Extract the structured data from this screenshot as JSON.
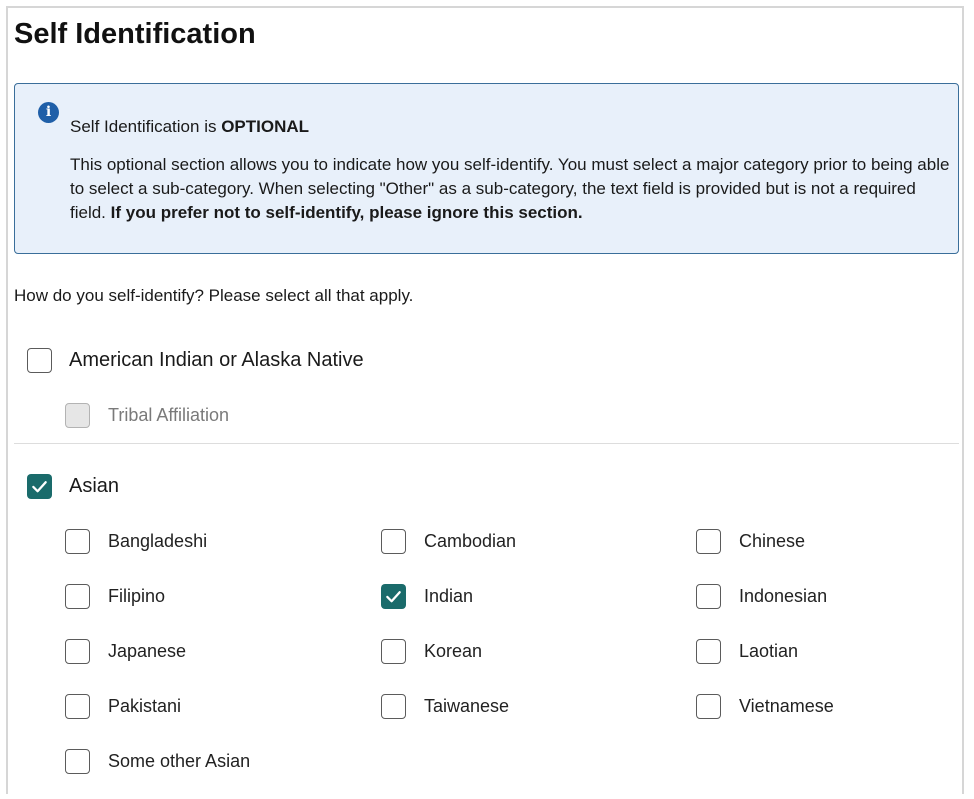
{
  "page": {
    "title": "Self Identification"
  },
  "info": {
    "icon": "info-icon",
    "heading_prefix": "Self Identification is ",
    "heading_emphasis": "OPTIONAL",
    "body_text": "This optional section allows you to indicate how you self-identify. You must select a major category prior to being able to select a sub-category. When selecting \"Other\" as a sub-category, the text field is provided but is not a required field. ",
    "body_emphasis": "If you prefer not to self-identify, please ignore this section."
  },
  "question": "How do you self-identify? Please select all that apply.",
  "colors": {
    "accent": "#1a6b6b",
    "info_bg": "#e8f0fa",
    "info_border": "#3a6e9a",
    "info_icon": "#1f5fa8"
  },
  "categories": [
    {
      "label": "American Indian or Alaska Native",
      "checked": false,
      "subcategories": [
        {
          "label": "Tribal Affiliation",
          "checked": false,
          "disabled": true
        }
      ]
    },
    {
      "label": "Asian",
      "checked": true,
      "subcategories": [
        {
          "label": "Bangladeshi",
          "checked": false,
          "disabled": false
        },
        {
          "label": "Cambodian",
          "checked": false,
          "disabled": false
        },
        {
          "label": "Chinese",
          "checked": false,
          "disabled": false
        },
        {
          "label": "Filipino",
          "checked": false,
          "disabled": false
        },
        {
          "label": "Indian",
          "checked": true,
          "disabled": false
        },
        {
          "label": "Indonesian",
          "checked": false,
          "disabled": false
        },
        {
          "label": "Japanese",
          "checked": false,
          "disabled": false
        },
        {
          "label": "Korean",
          "checked": false,
          "disabled": false
        },
        {
          "label": "Laotian",
          "checked": false,
          "disabled": false
        },
        {
          "label": "Pakistani",
          "checked": false,
          "disabled": false
        },
        {
          "label": "Taiwanese",
          "checked": false,
          "disabled": false
        },
        {
          "label": "Vietnamese",
          "checked": false,
          "disabled": false
        },
        {
          "label": "Some other Asian",
          "checked": false,
          "disabled": false
        }
      ]
    }
  ]
}
